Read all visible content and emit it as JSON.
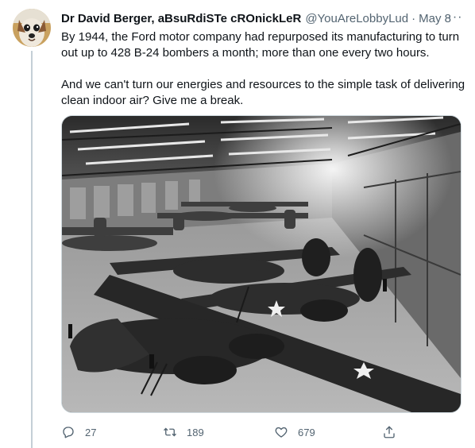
{
  "tweet": {
    "author_name": "Dr David Berger, aBsuRdiSTe cROnickLeR",
    "handle": "@YouAreLobbyLud",
    "separator": "·",
    "date": "May 8",
    "more_glyph": "···",
    "paragraphs": [
      "By 1944, the Ford motor company had repurposed its manufacturing to turn out up to 428 B-24 bombers a month; more than one every two hours.",
      "And we can't turn our energies and resources to the simple task of delivering clean indoor air? Give me a break."
    ],
    "photo_icon": "factory-photo",
    "avatar_icon": "dog-avatar"
  },
  "actions": {
    "reply": {
      "icon": "reply-icon",
      "count": "27"
    },
    "retweet": {
      "icon": "retweet-icon",
      "count": "189"
    },
    "like": {
      "icon": "heart-icon",
      "count": "679"
    },
    "share": {
      "icon": "share-icon"
    }
  },
  "colors": {
    "text": "#0f1419",
    "secondary": "#536471",
    "thread_line": "#c4cfd6",
    "background": "#ffffff"
  }
}
